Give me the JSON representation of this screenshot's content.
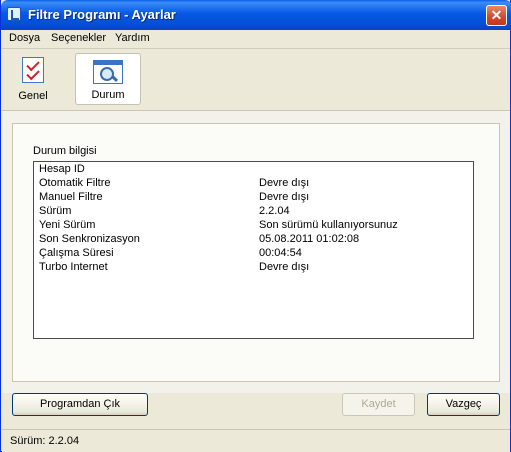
{
  "window": {
    "title": "Filtre Programı - Ayarlar"
  },
  "menu": {
    "items": [
      "Dosya",
      "Seçenekler",
      "Yardım"
    ]
  },
  "toolbar": {
    "tabs": [
      {
        "label": "Genel",
        "icon": "checklist-icon"
      },
      {
        "label": "Durum",
        "icon": "magnifier-icon"
      }
    ],
    "selected": "Durum"
  },
  "panel": {
    "heading": "Durum bilgisi",
    "rows": [
      {
        "key": "Hesap ID",
        "value": ""
      },
      {
        "key": "Otomatik Filtre",
        "value": "Devre dışı"
      },
      {
        "key": "Manuel Filtre",
        "value": "Devre dışı"
      },
      {
        "key": "Sürüm",
        "value": "2.2.04"
      },
      {
        "key": "Yeni Sürüm",
        "value": "Son sürümü kullanıyorsunuz"
      },
      {
        "key": "Son Senkronizasyon",
        "value": "05.08.2011 01:02:08"
      },
      {
        "key": "Çalışma Süresi",
        "value": "00:04:54"
      },
      {
        "key": "Turbo Internet",
        "value": "Devre dışı"
      }
    ]
  },
  "buttons": {
    "exit": "Programdan Çık",
    "save": "Kaydet",
    "cancel": "Vazgeç"
  },
  "status": {
    "text": "Sürüm: 2.2.04"
  }
}
